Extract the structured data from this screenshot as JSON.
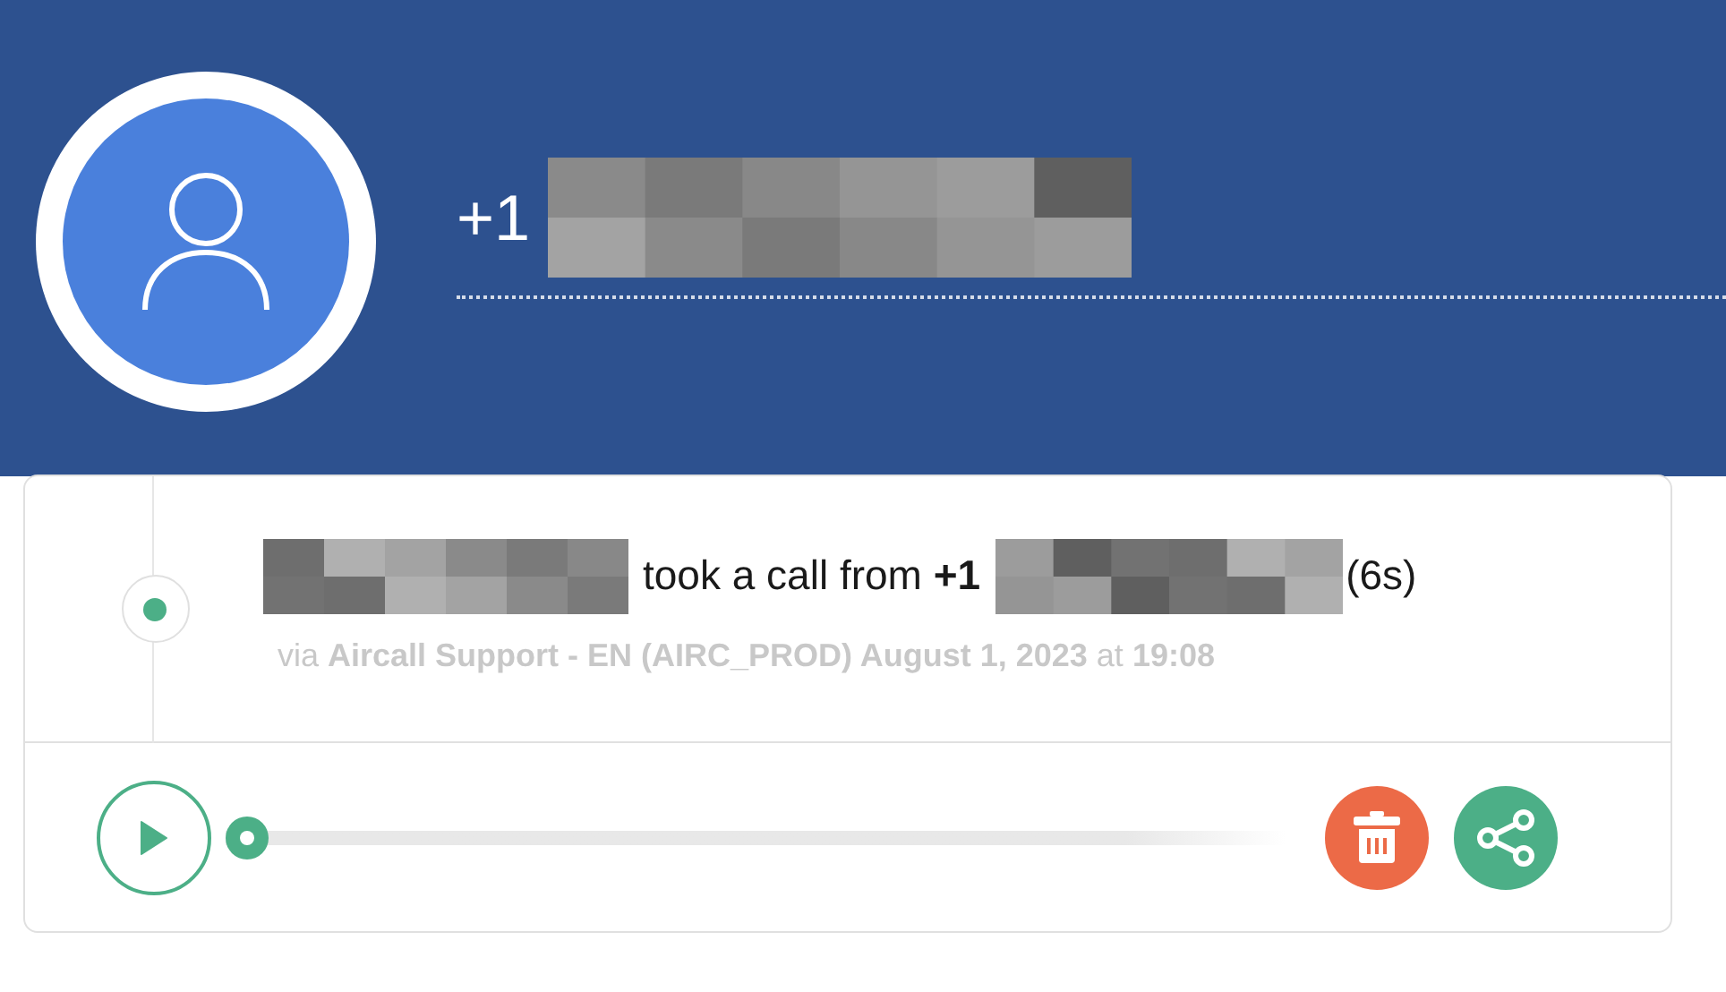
{
  "contact": {
    "number_prefix": "+1"
  },
  "call": {
    "summary": "took a call from **+1**",
    "duration": "(6s)",
    "details": "via **Aircall Support - EN (AIRC_PROD) August 1, 2023** at **19:08**"
  }
}
